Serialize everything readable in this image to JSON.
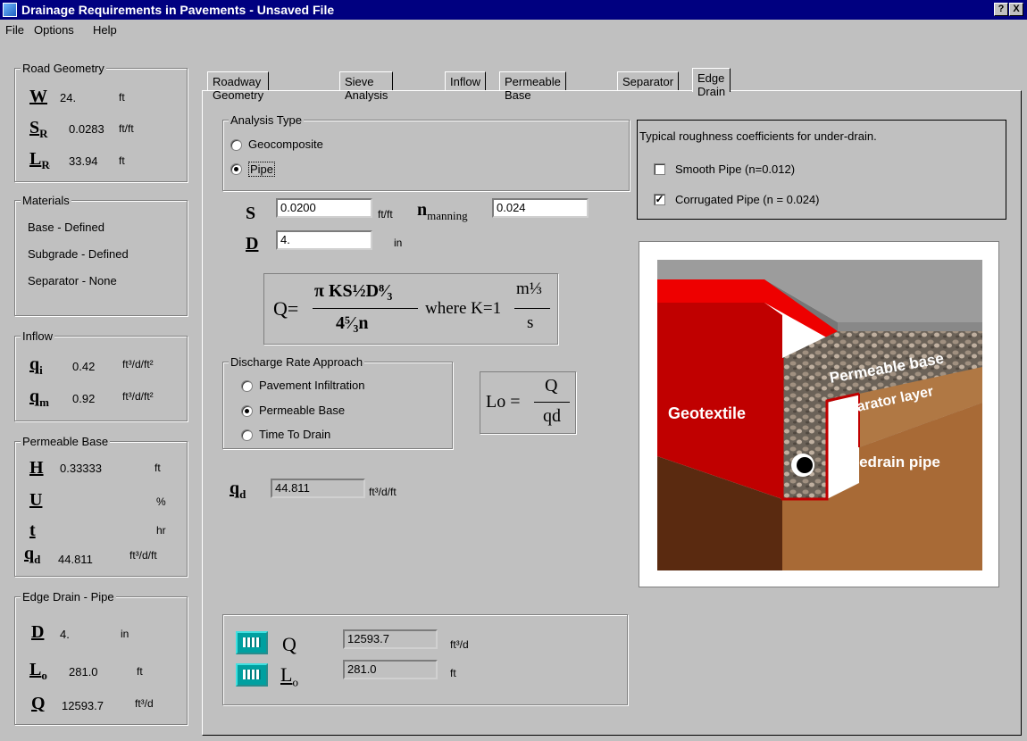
{
  "window": {
    "title": "Drainage Requirements in Pavements - Unsaved File",
    "help_btn": "?",
    "close_btn": "X"
  },
  "menu": [
    "File",
    "Options",
    "Help"
  ],
  "sidebar": {
    "road_geometry": {
      "title": "Road Geometry",
      "W": {
        "sym": "W",
        "value": "24.",
        "unit": "ft"
      },
      "SR": {
        "sym": "S",
        "sub": "R",
        "value": "0.0283",
        "unit": "ft/ft"
      },
      "LR": {
        "sym": "L",
        "sub": "R",
        "value": "33.94",
        "unit": "ft"
      }
    },
    "materials": {
      "title": "Materials",
      "items": [
        "Base - Defined",
        "Subgrade - Defined",
        "Separator - None"
      ]
    },
    "inflow": {
      "title": "Inflow",
      "qi": {
        "sym": "q",
        "sub": "i",
        "value": "0.42",
        "unit": "ft³/d/ft²"
      },
      "qm": {
        "sym": "q",
        "sub": "m",
        "value": "0.92",
        "unit": "ft³/d/ft²"
      }
    },
    "permeable_base": {
      "title": "Permeable Base",
      "H": {
        "sym": "H",
        "value": "0.33333",
        "unit": "ft"
      },
      "U": {
        "sym": "U",
        "value": "",
        "unit": "%"
      },
      "t": {
        "sym": "t",
        "value": "",
        "unit": "hr"
      },
      "qd": {
        "sym": "q",
        "sub": "d",
        "value": "44.811",
        "unit": "ft³/d/ft"
      }
    },
    "edge_drain": {
      "title": "Edge Drain - Pipe",
      "D": {
        "sym": "D",
        "value": "4.",
        "unit": "in"
      },
      "Lo": {
        "sym": "L",
        "sub": "o",
        "value": "281.0",
        "unit": "ft"
      },
      "Q": {
        "sym": "Q",
        "value": "12593.7",
        "unit": "ft³/d"
      }
    }
  },
  "tabs": [
    "Roadway Geometry",
    "Sieve Analysis",
    "Inflow",
    "Permeable Base",
    "Separator",
    "Edge Drain"
  ],
  "analysis_type": {
    "title": "Analysis Type",
    "options": [
      "Geocomposite",
      "Pipe"
    ],
    "selected": "Pipe"
  },
  "inputs": {
    "S": {
      "sym": "S",
      "value": "0.0200",
      "unit": "ft/ft"
    },
    "n": {
      "sym": "n",
      "sub": "manning",
      "value": "0.024"
    },
    "D": {
      "sym": "D",
      "value": "4.",
      "unit": "in"
    }
  },
  "formula_q": {
    "lhs": "Q=",
    "numerator": "π KS½D⁸⁄₃",
    "denominator": "4⁵⁄₃n",
    "where": "where K=1",
    "k_num": "m⅓",
    "k_den": "s"
  },
  "discharge": {
    "title": "Discharge Rate Approach",
    "options": [
      "Pavement Infiltration",
      "Permeable Base",
      "Time To Drain"
    ],
    "selected": "Permeable Base"
  },
  "formula_lo": {
    "lhs": "Lo =",
    "num": "Q",
    "den": "qd"
  },
  "qd_field": {
    "sym": "q",
    "sub": "d",
    "value": "44.811",
    "unit": "ft³/d/ft"
  },
  "roughness": {
    "title": "Typical roughness coefficients for under-drain.",
    "options": [
      {
        "label": "Smooth Pipe (n=0.012)",
        "checked": false
      },
      {
        "label": "Corrugated Pipe (n = 0.024)",
        "checked": true
      }
    ]
  },
  "diagram": {
    "labels": [
      "Permeable base",
      "Separator layer",
      "Geotextile",
      "Edgedrain pipe"
    ]
  },
  "results": {
    "Q": {
      "sym": "Q",
      "value": "12593.7",
      "unit": "ft³/d"
    },
    "Lo": {
      "sym": "L",
      "sub": "o",
      "value": "281.0",
      "unit": "ft"
    }
  }
}
